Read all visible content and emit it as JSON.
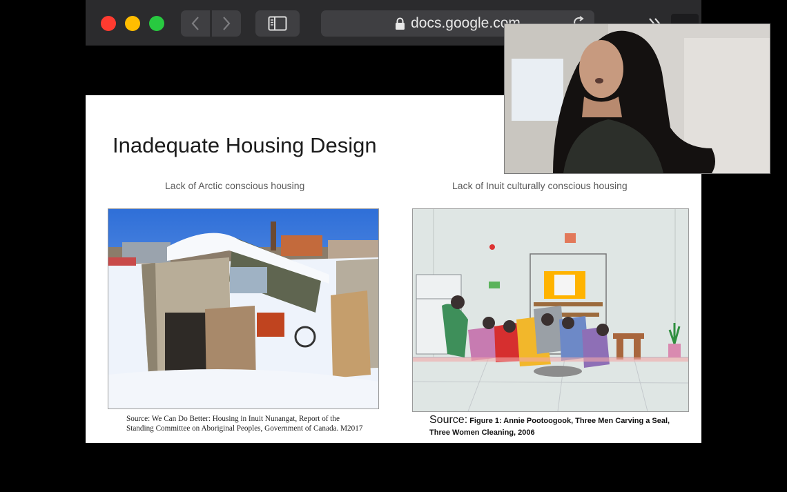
{
  "browser": {
    "url": "docs.google.com"
  },
  "slide": {
    "title": "Inadequate Housing Design",
    "subtitle_left": "Lack of Arctic conscious housing",
    "subtitle_right": "Lack of Inuit culturally conscious housing",
    "source_left": "Source: We Can Do Better: Housing in Inuit Nunangat, Report of the Standing Committee on Aboriginal Peoples, Government of Canada. M2017",
    "source_right_label": "Source:",
    "source_right_text": "Figure 1: Annie Pootoogook, Three Men Carving a Seal, Three Women Cleaning, 2006"
  },
  "colors": {
    "titlebar": "#2b2b2d",
    "close": "#ff3b30",
    "minimize": "#ffbd00",
    "zoom": "#28c940"
  },
  "icons": {
    "back": "chevron-left-icon",
    "forward": "chevron-right-icon",
    "sidebar": "sidebar-icon",
    "lock": "lock-icon",
    "reload": "reload-icon",
    "more": "double-chevron-icon"
  }
}
